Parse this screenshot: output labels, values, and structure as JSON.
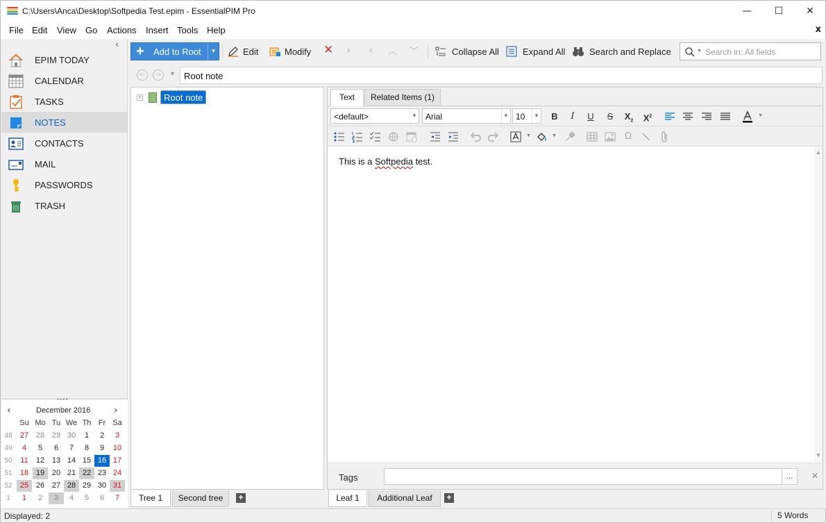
{
  "window": {
    "title": "C:\\Users\\Anca\\Desktop\\Softpedia Test.epim - EssentialPIM Pro",
    "minimize": "—",
    "maximize": "☐",
    "close": "✕"
  },
  "menu": {
    "items": [
      "File",
      "Edit",
      "View",
      "Go",
      "Actions",
      "Insert",
      "Tools",
      "Help"
    ],
    "close": "x"
  },
  "sidebar": {
    "items": [
      {
        "label": "EPIM TODAY",
        "icon": "home-icon"
      },
      {
        "label": "CALENDAR",
        "icon": "calendar-icon"
      },
      {
        "label": "TASKS",
        "icon": "tasks-icon"
      },
      {
        "label": "NOTES",
        "icon": "notes-icon",
        "active": true
      },
      {
        "label": "CONTACTS",
        "icon": "contacts-icon"
      },
      {
        "label": "MAIL",
        "icon": "mail-icon"
      },
      {
        "label": "PASSWORDS",
        "icon": "key-icon"
      },
      {
        "label": "TRASH",
        "icon": "trash-icon"
      }
    ]
  },
  "mini_calendar": {
    "month_label": "December  2016",
    "weekday_headers": [
      "Su",
      "Mo",
      "Tu",
      "We",
      "Th",
      "Fr",
      "Sa"
    ],
    "weeks": [
      {
        "week": "48",
        "days": [
          "27",
          "28",
          "29",
          "30",
          "1",
          "2",
          "3"
        ]
      },
      {
        "week": "49",
        "days": [
          "4",
          "5",
          "6",
          "7",
          "8",
          "9",
          "10"
        ]
      },
      {
        "week": "50",
        "days": [
          "11",
          "12",
          "13",
          "14",
          "15",
          "16",
          "17"
        ]
      },
      {
        "week": "51",
        "days": [
          "18",
          "19",
          "20",
          "21",
          "22",
          "23",
          "24"
        ]
      },
      {
        "week": "52",
        "days": [
          "25",
          "26",
          "27",
          "28",
          "29",
          "30",
          "31"
        ]
      },
      {
        "week": "1",
        "days": [
          "1",
          "2",
          "3",
          "4",
          "5",
          "6",
          "7"
        ]
      }
    ],
    "today": "16"
  },
  "toolbar": {
    "add_to_root": "Add to Root",
    "edit": "Edit",
    "modify": "Modify",
    "collapse_all": "Collapse All",
    "expand_all": "Expand All",
    "search_replace": "Search and Replace",
    "search_placeholder": "Search in: All fields"
  },
  "path": {
    "current": "Root note"
  },
  "tree": {
    "root_node": "Root note",
    "tabs": [
      "Tree 1",
      "Second tree"
    ],
    "add_tab": "+"
  },
  "editor": {
    "tabs": [
      "Text",
      "Related Items  (1)"
    ],
    "style": "<default>",
    "font": "Arial",
    "size": "10",
    "body_before": "This is a ",
    "body_word": "Softpedia",
    "body_after": " test.",
    "tags_label": "Tags",
    "tags_more": "...",
    "tags_clear": "✕",
    "leaf_tabs": [
      "Leaf 1",
      "Additional Leaf"
    ],
    "add_leaf": "+"
  },
  "status": {
    "left": "Displayed: 2",
    "right": "5 Words"
  },
  "colors": {
    "accent": "#0a6bd1",
    "weekend_red": "#dd1111",
    "add_button": "#3d8ad8"
  }
}
